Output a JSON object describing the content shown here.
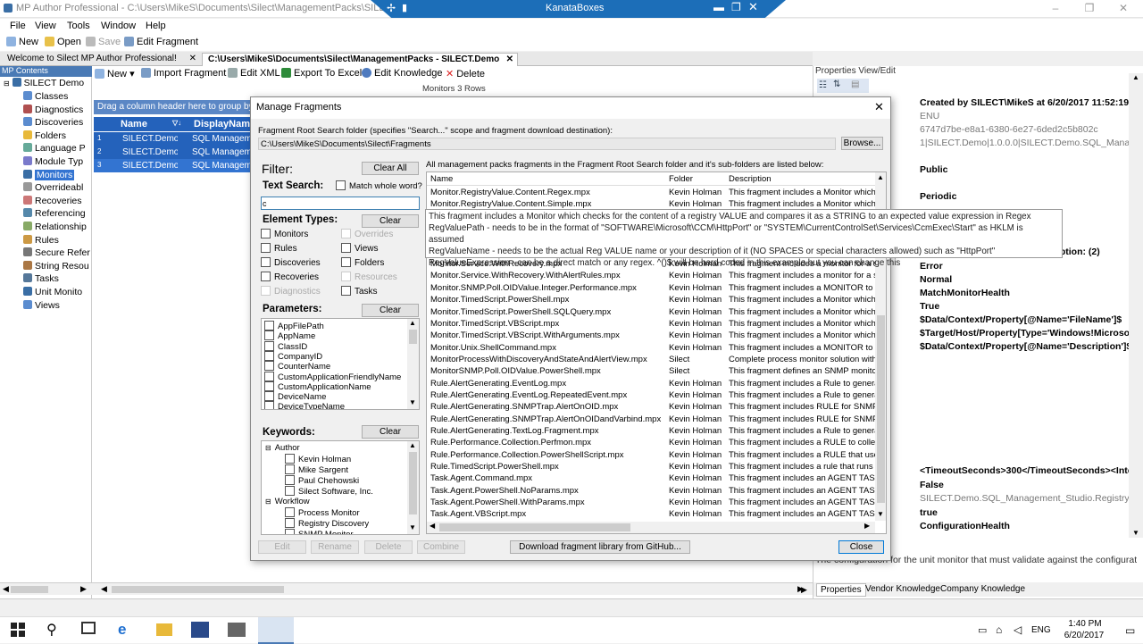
{
  "app": {
    "title": "MP Author Professional - C:\\Users\\MikeS\\Documents\\Silect\\ManagementPacks\\SILECT.D",
    "remote_title": "KanataBoxes"
  },
  "menu": [
    "File",
    "View",
    "Tools",
    "Window",
    "Help"
  ],
  "toolbar": {
    "new": "New",
    "open": "Open",
    "save": "Save",
    "edit_fragment": "Edit Fragment"
  },
  "tabs": [
    {
      "label": "Welcome to Silect MP Author Professional!"
    },
    {
      "label": "C:\\Users\\MikeS\\Documents\\Silect\\ManagementPacks - SILECT.Demo"
    }
  ],
  "left": {
    "header": "MP Contents",
    "root": "SILECT Demo",
    "items": [
      "Classes",
      "Diagnostics",
      "Discoveries",
      "Folders",
      "Language P",
      "Module Typ",
      "Monitors",
      "Overrideabl",
      "Recoveries",
      "Referencing",
      "Relationship",
      "Rules",
      "Secure Refer",
      "String Resou",
      "Tasks",
      "Unit Monito",
      "Views"
    ]
  },
  "center": {
    "toolbar": {
      "new": "New",
      "import": "Import Fragment",
      "edit_xml": "Edit XML",
      "export": "Export To Excel",
      "edit_knowledge": "Edit Knowledge",
      "delete": "Delete"
    },
    "status": "Monitors 3 Rows",
    "group_hint": "Drag a column header here to group by",
    "columns": [
      "Name",
      "DisplayNam"
    ],
    "rows": [
      {
        "num": "1",
        "name": "SILECT.Demo.S",
        "display": "SQL Managemen"
      },
      {
        "num": "2",
        "name": "SILECT.Demo.S",
        "display": "SQL Managemen"
      },
      {
        "num": "3",
        "name": "SILECT.Demo.S",
        "display": "SQL Managem"
      }
    ]
  },
  "right": {
    "header": "Properties View/Edit",
    "created": "Created by SILECT\\MikeS at 6/20/2017 11:52:19 A",
    "lines": [
      "ENU",
      "6747d7be-e8a1-6380-6e27-6ded2c5b802c",
      "1|SILECT.Demo|1.0.0.0|SILECT.Demo.SQL_Managem",
      "Public",
      "Periodic",
      "cription: (2)",
      "Error",
      "Normal",
      "MatchMonitorHealth",
      "True",
      "$Data/Context/Property[@Name='FileName']$",
      "$Target/Host/Property[Type='Windows!Microsof",
      "$Data/Context/Property[@Name='Description']$",
      "<TimeoutSeconds>300</TimeoutSeconds><Inte",
      "False",
      "SILECT.Demo.SQL_Management_Studio.Registry.Class",
      "true",
      "ConfigurationHealth"
    ],
    "bottom_text": "The configuration for the unit monitor that must validate against the configurat...",
    "tabs": [
      "Properties",
      "Vendor Knowledge",
      "Company Knowledge"
    ]
  },
  "dialog": {
    "title": "Manage Fragments",
    "root_label": "Fragment Root Search folder (specifies \"Search...\" scope and fragment download destination):",
    "root_path": "C:\\Users\\MikeS\\Documents\\Silect\\Fragments",
    "browse": "Browse...",
    "filter": "Filter:",
    "clear_all": "Clear All",
    "text_search": "Text Search:",
    "match_whole": "Match whole word?",
    "search_value": "c",
    "element_types": "Element Types:",
    "clear": "Clear",
    "types": [
      {
        "label": "Monitors",
        "enabled": true
      },
      {
        "label": "Overrides",
        "enabled": false
      },
      {
        "label": "Rules",
        "enabled": true
      },
      {
        "label": "Views",
        "enabled": true
      },
      {
        "label": "Discoveries",
        "enabled": true
      },
      {
        "label": "Folders",
        "enabled": true
      },
      {
        "label": "Recoveries",
        "enabled": true
      },
      {
        "label": "Resources",
        "enabled": false
      },
      {
        "label": "Diagnostics",
        "enabled": false
      },
      {
        "label": "Tasks",
        "enabled": true
      }
    ],
    "parameters": "Parameters:",
    "params": [
      "AppFilePath",
      "AppName",
      "ClassID",
      "CompanyID",
      "CounterName",
      "CustomApplicationFriendlyName",
      "CustomApplicationName",
      "DeviceName",
      "DeviceTypeName"
    ],
    "keywords": "Keywords:",
    "kw_tree": [
      {
        "label": "Author",
        "level": 0
      },
      {
        "label": "Kevin Holman",
        "level": 1
      },
      {
        "label": "Mike Sargent",
        "level": 1
      },
      {
        "label": "Paul Chehowski",
        "level": 1
      },
      {
        "label": "Silect Software, Inc.",
        "level": 1
      },
      {
        "label": "Workflow",
        "level": 0
      },
      {
        "label": "Process Monitor",
        "level": 1
      },
      {
        "label": "Registry Discovery",
        "level": 1
      },
      {
        "label": "SNMP Monitor",
        "level": 1
      }
    ],
    "list_caption": "All management packs fragments in the Fragment Root Search folder and it's sub-folders are listed below:",
    "columns": [
      "Name",
      "Folder",
      "Description"
    ],
    "fragments": [
      {
        "name": "Monitor.RegistryValue.Content.Regex.mpx",
        "folder": "Kevin Holman",
        "desc": "This fragment includes a Monitor which ch"
      },
      {
        "name": "Monitor.RegistryValue.Content.Simple.mpx",
        "folder": "Kevin Holman",
        "desc": "This fragment includes a Monitor which ch"
      },
      {
        "name": "",
        "folder": "",
        "desc": ""
      },
      {
        "name": "",
        "folder": "",
        "desc": ""
      },
      {
        "name": "",
        "folder": "",
        "desc": ""
      },
      {
        "name": "",
        "folder": "",
        "desc": ""
      },
      {
        "name": "Monitor.Service.WithRecovery.mpx",
        "folder": "Kevin Holman",
        "desc": "This fragment includes a monitor for a ser"
      },
      {
        "name": "Monitor.Service.WithRecovery.WithAlertRules.mpx",
        "folder": "Kevin Holman",
        "desc": "This fragment includes a monitor for a ser"
      },
      {
        "name": "Monitor.SNMP.Poll.OIDValue.Integer.Performance.mpx",
        "folder": "Kevin Holman",
        "desc": "This fragment includes a MONITOR to qu"
      },
      {
        "name": "Monitor.TimedScript.PowerShell.mpx",
        "folder": "Kevin Holman",
        "desc": "This fragment includes a Monitor which ru"
      },
      {
        "name": "Monitor.TimedScript.PowerShell.SQLQuery.mpx",
        "folder": "Kevin Holman",
        "desc": "This fragment includes a Monitor which ru"
      },
      {
        "name": "Monitor.TimedScript.VBScript.mpx",
        "folder": "Kevin Holman",
        "desc": "This fragment includes a Monitor which ru"
      },
      {
        "name": "Monitor.TimedScript.VBScript.WithArguments.mpx",
        "folder": "Kevin Holman",
        "desc": "This fragment includes a Monitor which ru"
      },
      {
        "name": "Monitor.Unix.ShellCommand.mpx",
        "folder": "Kevin Holman",
        "desc": "This fragment includes a MONITOR to run"
      },
      {
        "name": "MonitorProcessWithDiscoveryAndStateAndAlertView.mpx",
        "folder": "Silect",
        "desc": "Complete process monitor solution with al"
      },
      {
        "name": "MonitorSNMP.Poll.OIDValue.PowerShell.mpx",
        "folder": "Silect",
        "desc": "This fragment defines an SNMP monitor w"
      },
      {
        "name": "Rule.AlertGenerating.EventLog.mpx",
        "folder": "Kevin Holman",
        "desc": "This fragment includes a Rule to generate"
      },
      {
        "name": "Rule.AlertGenerating.EventLog.RepeatedEvent.mpx",
        "folder": "Kevin Holman",
        "desc": "This fragment includes a Rule to generate"
      },
      {
        "name": "Rule.AlertGenerating.SNMPTrap.AlertOnOID.mpx",
        "folder": "Kevin Holman",
        "desc": "This fragment includes RULE for SNMP tr"
      },
      {
        "name": "Rule.AlertGenerating.SNMPTrap.AlertOnOIDandVarbind.mpx",
        "folder": "Kevin Holman",
        "desc": "This fragment includes RULE for SNMP tr"
      },
      {
        "name": "Rule.AlertGenerating.TextLog.Fragment.mpx",
        "folder": "Kevin Holman",
        "desc": "This fragment includes a Rule to generate"
      },
      {
        "name": "Rule.Performance.Collection.Perfmon.mpx",
        "folder": "Kevin Holman",
        "desc": "This fragment includes a RULE to collect"
      },
      {
        "name": "Rule.Performance.Collection.PowerShellScript.mpx",
        "folder": "Kevin Holman",
        "desc": "This fragment includes a RULE that uses"
      },
      {
        "name": "Rule.TimedScript.PowerShell.mpx",
        "folder": "Kevin Holman",
        "desc": "This fragment includes a rule that runs a P"
      },
      {
        "name": "Task.Agent.Command.mpx",
        "folder": "Kevin Holman",
        "desc": "This fragment includes an AGENT TASK"
      },
      {
        "name": "Task.Agent.PowerShell.NoParams.mpx",
        "folder": "Kevin Holman",
        "desc": "This fragment includes an AGENT TASK"
      },
      {
        "name": "Task.Agent.PowerShell.WithParams.mpx",
        "folder": "Kevin Holman",
        "desc": "This fragment includes an AGENT TASK"
      },
      {
        "name": "Task.Agent.VBScript.mpx",
        "folder": "Kevin Holman",
        "desc": "This fragment includes an AGENT TASK"
      }
    ],
    "tooltip": [
      "This fragment includes a Monitor which checks for the content of a registry VALUE and compares it as a STRING to an expected value expression in Regex",
      "RegValuePath - needs to be in the format of \"SOFTWARE\\Microsoft\\CCM\\HttpPort\" or \"SYSTEM\\CurrentControlSet\\Services\\CcmExec\\Start\" as HKLM is assumed",
      "RegValueName - needs to be the actual Reg VALUE name or your description of it (NO SPACES or special characters allowed) such as \"HttpPort\"",
      "RegValueExpression - can be a direct match or any regex.  ^()$ will be hard coded in this example but you can change this"
    ],
    "bottom_buttons": [
      "Edit",
      "Rename",
      "Delete",
      "Combine"
    ],
    "download": "Download fragment library from GitHub...",
    "close": "Close"
  },
  "taskbar": {
    "lang": "ENG",
    "time": "1:40 PM",
    "date": "6/20/2017"
  }
}
